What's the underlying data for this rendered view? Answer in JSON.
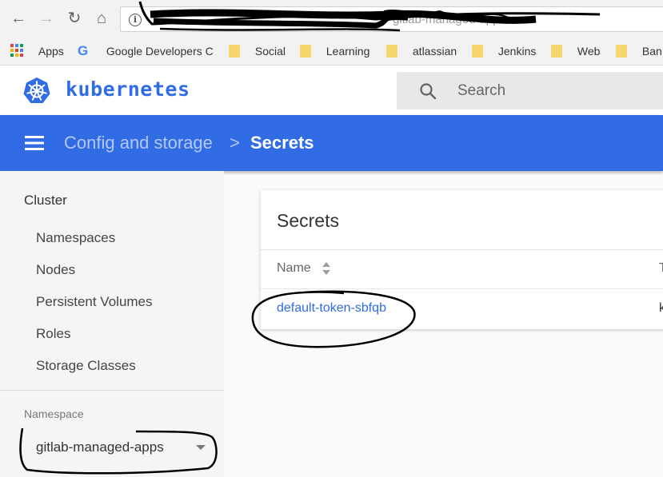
{
  "browser": {
    "address_visible_text": "gitlab-managed-apps",
    "bookmarks": [
      {
        "label": "Apps",
        "icon": "apps-grid-icon"
      },
      {
        "label": "Google Developers C",
        "icon": "google-icon"
      },
      {
        "label": "Social",
        "icon": "folder-icon"
      },
      {
        "label": "Learning",
        "icon": "folder-icon"
      },
      {
        "label": "atlassian",
        "icon": "folder-icon"
      },
      {
        "label": "Jenkins",
        "icon": "folder-icon"
      },
      {
        "label": "Web",
        "icon": "folder-icon"
      },
      {
        "label": "Ban",
        "icon": "folder-icon"
      }
    ]
  },
  "header": {
    "title": "kubernetes",
    "search_placeholder": "Search"
  },
  "breadcrumb": {
    "parent": "Config and storage",
    "separator": ">",
    "current": "Secrets"
  },
  "sidebar": {
    "heading": "Cluster",
    "items": [
      "Namespaces",
      "Nodes",
      "Persistent Volumes",
      "Roles",
      "Storage Classes"
    ],
    "namespace_label": "Namespace",
    "namespace_value": "gitlab-managed-apps"
  },
  "card": {
    "title": "Secrets",
    "columns": [
      "Name",
      "T"
    ],
    "rows": [
      {
        "name": "default-token-sbfqb",
        "type": "k"
      }
    ]
  },
  "colors": {
    "k8s_blue": "#326ce5",
    "folder_yellow": "#f5d76e"
  }
}
